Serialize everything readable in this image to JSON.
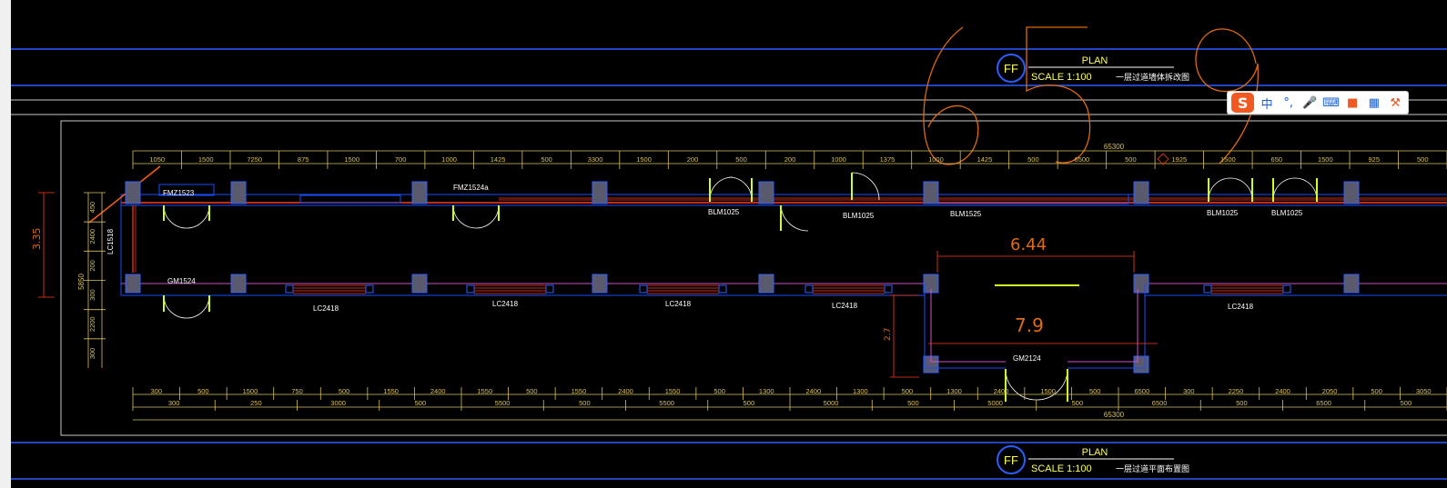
{
  "title_blocks": [
    {
      "badge": "FF",
      "plan": "PLAN",
      "scale": "SCALE 1:100",
      "name": "一层过道墙体拆改图"
    },
    {
      "badge": "FF",
      "plan": "PLAN",
      "scale": "SCALE 1:100",
      "name": "一层过道平面布置图"
    }
  ],
  "handwritten": {
    "big_top": "659",
    "dim_a": "6.44",
    "dim_b": "7.9",
    "dim_v": "3.35",
    "dim_small": "2.7"
  },
  "labels": {
    "doors_top": [
      "FMZ1523",
      "FMZ1524a"
    ],
    "door_left": "GM1524",
    "door_side": "LC1518",
    "blinds": [
      "BLM1025",
      "BLM1025",
      "BLM1525",
      "BLM1025",
      "BLM1025"
    ],
    "windows": [
      "LC2418",
      "LC2418",
      "LC2418",
      "LC2418",
      "LC2418"
    ],
    "door_bottom": "GM2124"
  },
  "dimensions": {
    "top_total": "65300",
    "top_row": [
      "1050",
      "1500",
      "7250",
      "875",
      "1500",
      "700",
      "1000",
      "1425",
      "500",
      "3300",
      "1500",
      "200",
      "500",
      "200",
      "1000",
      "1375",
      "1000",
      "1425",
      "500",
      "6500",
      "500",
      "1925",
      "1500",
      "650",
      "1500",
      "925",
      "500"
    ],
    "left_col": [
      "450",
      "2400",
      "200",
      "300",
      "2200",
      "300"
    ],
    "left_total": "5850",
    "bottom_row1": [
      "300",
      "500",
      "1500",
      "750",
      "500",
      "1550",
      "2400",
      "1550",
      "500",
      "1550",
      "2400",
      "1550",
      "500",
      "1300",
      "2400",
      "1300",
      "500",
      "1300",
      "2400",
      "1500",
      "500",
      "6500",
      "300",
      "2250",
      "2400",
      "2050",
      "500",
      "3050"
    ],
    "bottom_row2": [
      "300",
      "250",
      "3000",
      "500",
      "5500",
      "500",
      "5500",
      "500",
      "5000",
      "500",
      "5000",
      "500",
      "6500",
      "500",
      "6500",
      "500"
    ],
    "bottom_total": "65300"
  },
  "ime_toolbar": {
    "logo": "S",
    "items": [
      "中",
      "°,",
      "mic-icon",
      "keyboard-icon",
      "shirt-icon",
      "grid-icon",
      "tools-icon"
    ]
  },
  "colors": {
    "background": "#000000",
    "cad_blue": "#1a4fff",
    "cad_red": "#ff3a1a",
    "cad_magenta": "#d050d0",
    "cad_yellow": "#ffff40",
    "cad_orange": "#e06a10",
    "cad_dim": "#d8c060",
    "wall_fill": "#5a5a6e"
  }
}
